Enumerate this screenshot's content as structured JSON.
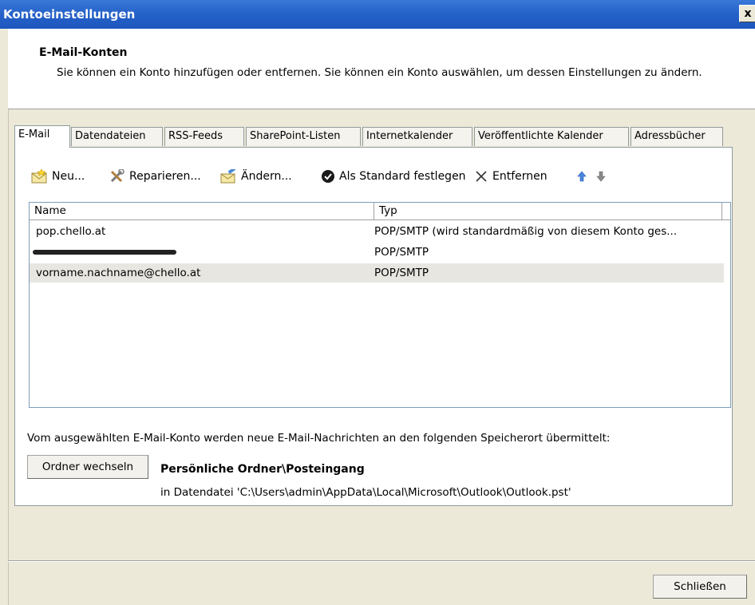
{
  "window": {
    "title": "Kontoeinstellungen",
    "close_label": "x"
  },
  "header": {
    "title": "E-Mail-Konten",
    "description": "Sie können ein Konto hinzufügen oder entfernen. Sie können ein Konto auswählen, um dessen Einstellungen zu ändern."
  },
  "tabs": [
    {
      "label": "E-Mail",
      "active": true
    },
    {
      "label": "Datendateien"
    },
    {
      "label": "RSS-Feeds"
    },
    {
      "label": "SharePoint-Listen"
    },
    {
      "label": "Internetkalender"
    },
    {
      "label": "Veröffentlichte Kalender"
    },
    {
      "label": "Adressbücher"
    }
  ],
  "toolbar": {
    "new_label": "Neu...",
    "repair_label": "Reparieren...",
    "change_label": "Ändern...",
    "default_label": "Als Standard festlegen",
    "remove_label": "Entfernen"
  },
  "accounts_table": {
    "columns": [
      "Name",
      "Typ"
    ],
    "rows": [
      {
        "name": "pop.chello.at",
        "type": "POP/SMTP (wird standardmäßig von diesem Konto ges..."
      },
      {
        "name": "",
        "type": "POP/SMTP",
        "redacted": true
      },
      {
        "name": "vorname.nachname@chello.at",
        "type": "POP/SMTP",
        "selected": true
      }
    ]
  },
  "delivery": {
    "info": "Vom ausgewählten E-Mail-Konto werden neue E-Mail-Nachrichten an den folgenden Speicherort übermittelt:",
    "change_folder_label": "Ordner wechseln",
    "folder": "Persönliche Ordner\\Posteingang",
    "data_file": "in Datendatei 'C:\\Users\\admin\\AppData\\Local\\Microsoft\\Outlook\\Outlook.pst'"
  },
  "footer": {
    "close_label": "Schließen"
  },
  "colors": {
    "titlebar": "#2461c8",
    "dialog_bg": "#ece9d8",
    "selection": "#e8e6e1"
  }
}
